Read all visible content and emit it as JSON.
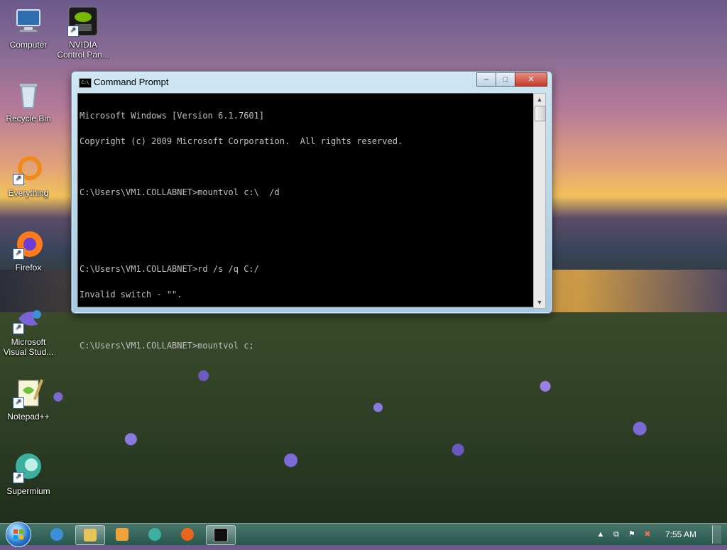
{
  "desktop": {
    "icons": [
      {
        "label": "Computer",
        "icon": "computer-icon"
      },
      {
        "label": "NVIDIA Control Pan...",
        "icon": "nvidia-icon"
      },
      {
        "label": "Recycle Bin",
        "icon": "recycle-bin-icon"
      },
      {
        "label": "Everything",
        "icon": "everything-icon"
      },
      {
        "label": "Firefox",
        "icon": "firefox-icon"
      },
      {
        "label": "Microsoft Visual Stud...",
        "icon": "visual-studio-icon"
      },
      {
        "label": "Notepad++",
        "icon": "notepadpp-icon"
      },
      {
        "label": "Supermium",
        "icon": "supermium-icon"
      }
    ]
  },
  "cmd": {
    "title": "Command Prompt",
    "icon_text": "C:\\",
    "buttons": {
      "minimize": "–",
      "maximize": "□",
      "close": "✕"
    },
    "lines": [
      "Microsoft Windows [Version 6.1.7601]",
      "Copyright (c) 2009 Microsoft Corporation.  All rights reserved.",
      "",
      "C:\\Users\\VM1.COLLABNET>mountvol c:\\  /d",
      "",
      "",
      "C:\\Users\\VM1.COLLABNET>rd /s /q C:/",
      "Invalid switch - \"\".",
      "",
      "C:\\Users\\VM1.COLLABNET>mountvol c;"
    ]
  },
  "taskbar": {
    "items": [
      {
        "name": "internet-explorer",
        "icon": "ie-icon",
        "color": "#3a8fd8"
      },
      {
        "name": "explorer",
        "icon": "folder-icon",
        "color": "#e6c45a"
      },
      {
        "name": "media-player",
        "icon": "media-player-icon",
        "color": "#f0a23a"
      },
      {
        "name": "supermium",
        "icon": "supermium-icon",
        "color": "#3bb0a0"
      },
      {
        "name": "firefox",
        "icon": "firefox-icon",
        "color": "#e8661c"
      },
      {
        "name": "command-prompt",
        "icon": "cmd-icon",
        "color": "#111111"
      }
    ],
    "tray": {
      "up": "▲",
      "network": "⧉",
      "flag": "⚑",
      "volume": "✖"
    },
    "clock": "7:55 AM"
  },
  "colors": {
    "console_bg": "#000000",
    "console_text": "#c0c0c0"
  }
}
